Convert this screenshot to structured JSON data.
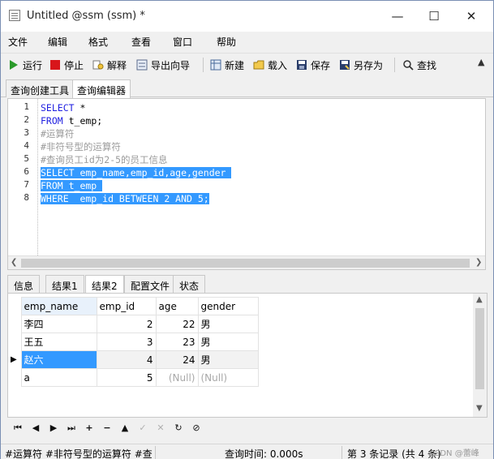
{
  "window": {
    "title": "Untitled @ssm (ssm) *"
  },
  "menu": [
    "文件",
    "编辑",
    "格式",
    "查看",
    "窗口",
    "帮助"
  ],
  "toolbar": {
    "run": "运行",
    "stop": "停止",
    "explain": "解释",
    "export_wizard": "导出向导",
    "new": "新建",
    "load": "载入",
    "save": "保存",
    "save_as": "另存为",
    "find": "查找"
  },
  "editor_tabs": [
    "查询创建工具",
    "查询编辑器"
  ],
  "editor": {
    "lines": [
      {
        "n": "1",
        "segments": [
          {
            "t": "SELECT",
            "c": "kw"
          },
          {
            "t": " *",
            "c": "plain"
          }
        ]
      },
      {
        "n": "2",
        "segments": [
          {
            "t": "FROM",
            "c": "kw"
          },
          {
            "t": " t_emp;",
            "c": "plain"
          }
        ]
      },
      {
        "n": "3",
        "segments": [
          {
            "t": "#运算符",
            "c": "cm"
          }
        ]
      },
      {
        "n": "4",
        "segments": [
          {
            "t": "#非符号型的运算符",
            "c": "cm"
          }
        ]
      },
      {
        "n": "5",
        "segments": [
          {
            "t": "#查询员工id为2-5的员工信息",
            "c": "cm"
          }
        ]
      },
      {
        "n": "6",
        "segments": [
          {
            "t": "SELECT emp_name,emp_id,age,gender ",
            "c": "sel"
          }
        ]
      },
      {
        "n": "7",
        "segments": [
          {
            "t": "FROM t_emp ",
            "c": "sel"
          }
        ]
      },
      {
        "n": "8",
        "segments": [
          {
            "t": "WHERE  emp_id BETWEEN 2 AND 5;",
            "c": "sel"
          }
        ]
      }
    ]
  },
  "result_tabs": [
    "信息",
    "结果1",
    "结果2",
    "配置文件",
    "状态"
  ],
  "grid": {
    "columns": [
      "emp_name",
      "emp_id",
      "age",
      "gender"
    ],
    "rows": [
      [
        "李四",
        "2",
        "22",
        "男"
      ],
      [
        "王五",
        "3",
        "23",
        "男"
      ],
      [
        "赵六",
        "4",
        "24",
        "男"
      ],
      [
        "a",
        "5",
        "(Null)",
        "(Null)"
      ]
    ]
  },
  "status": {
    "sql_preview": "#运算符 #非符号型的运算符 #查询",
    "query_time": "查询时间: 0.000s",
    "record": "第 3 条记录 (共 4 条)",
    "watermark": "CSDN @蕾峰"
  },
  "colors": {
    "selection": "#3399ff",
    "keyword": "#1e1ee0",
    "comment": "#9a9a9a"
  }
}
